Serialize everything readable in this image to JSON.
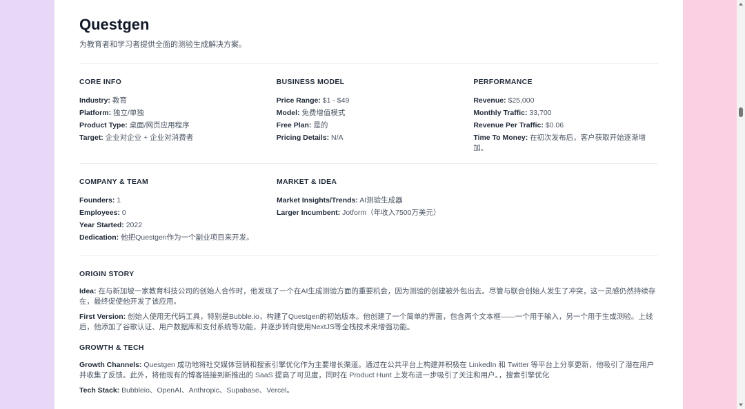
{
  "header": {
    "title": "Questgen",
    "subtitle": "为教育者和学习者提供全面的测验生成解决方案。"
  },
  "core_info": {
    "heading": "CORE INFO",
    "items": [
      {
        "label": "Industry:",
        "value": "教育"
      },
      {
        "label": "Platform:",
        "value": "独立/单独"
      },
      {
        "label": "Product Type:",
        "value": "桌面/网页应用程序"
      },
      {
        "label": "Target:",
        "value": "企业对企业 + 企业对消费者"
      }
    ]
  },
  "business_model": {
    "heading": "BUSINESS MODEL",
    "items": [
      {
        "label": "Price Range:",
        "value": "$1 - $49"
      },
      {
        "label": "Model:",
        "value": "免费增值模式"
      },
      {
        "label": "Free Plan:",
        "value": "是的"
      },
      {
        "label": "Pricing Details:",
        "value": "N/A"
      }
    ]
  },
  "performance": {
    "heading": "PERFORMANCE",
    "items": [
      {
        "label": "Revenue:",
        "value": "$25,000"
      },
      {
        "label": "Monthly Traffic:",
        "value": "33,700"
      },
      {
        "label": "Revenue Per Traffic:",
        "value": "$0.06"
      },
      {
        "label": "Time To Money:",
        "value": "在初次发布后，客户获取开始逐渐增加。"
      }
    ]
  },
  "company_team": {
    "heading": "COMPANY & TEAM",
    "items": [
      {
        "label": "Founders:",
        "value": "1"
      },
      {
        "label": "Employees:",
        "value": "0"
      },
      {
        "label": "Year Started:",
        "value": "2022"
      },
      {
        "label": "Dedication:",
        "value": "他把Questgen作为一个副业项目来开发。"
      }
    ]
  },
  "market_idea": {
    "heading": "MARKET & IDEA",
    "items": [
      {
        "label": "Market Insights/Trends:",
        "value": "AI测验生成器"
      },
      {
        "label": "Larger Incumbent:",
        "value": "Jotform（年收入7500万美元）"
      }
    ]
  },
  "origin_story": {
    "heading": "ORIGIN STORY",
    "items": [
      {
        "label": "Idea:",
        "value": "在与新加坡一家教育科技公司的创始人合作时，他发现了一个在AI生成测验方面的重要机会，因为测验的创建被外包出去。尽管与联合创始人发生了冲突，这一灵感仍然持续存在，最终促使他开发了该应用。"
      },
      {
        "label": "First Version:",
        "value": "创始人使用无代码工具，特别是Bubble.io，构建了Questgen的初始版本。他创建了一个简单的界面，包含两个文本框——一个用于输入，另一个用于生成测验。上线后，他添加了谷歌认证、用户数据库和支付系统等功能，并逐步转向使用NextJS等全栈技术来增强功能。"
      }
    ]
  },
  "growth_tech": {
    "heading": "GROWTH & TECH",
    "items": [
      {
        "label": "Growth Channels:",
        "value": "Questgen 成功地将社交媒体营销和搜索引擎优化作为主要增长渠道。通过在公共平台上构建并积极在 LinkedIn 和 Twitter 等平台上分享更新，他吸引了潜在用户并收集了反馈。此外，将他现有的博客链接到新推出的 SaaS 提高了可见度，同时在 Product Hunt 上发布进一步吸引了关注和用户。，搜索引擎优化"
      },
      {
        "label": "Tech Stack:",
        "value": "Bubbleio、OpenAI、Anthropic、Supabase、Vercel。"
      }
    ]
  }
}
